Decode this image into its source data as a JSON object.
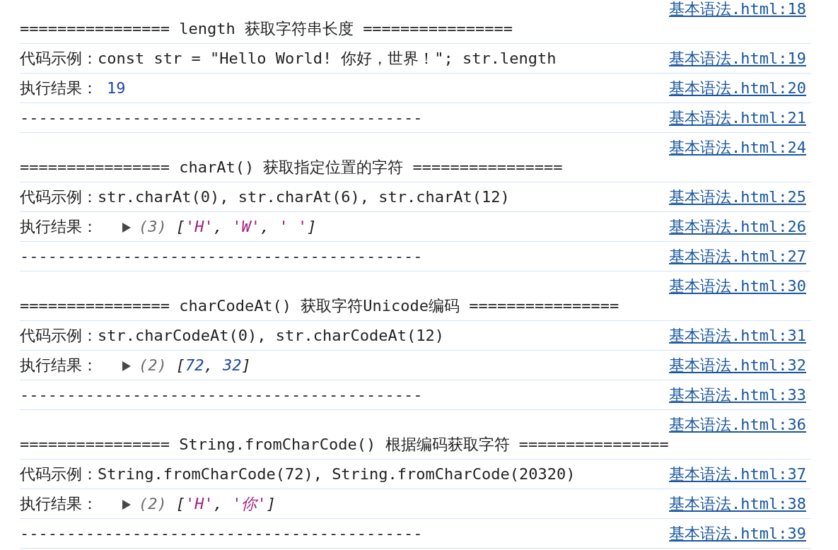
{
  "console": {
    "messages": [
      {
        "kind": "banner",
        "text": "================ length 获取字符串长度 ================",
        "source": "基本语法.html:18"
      },
      {
        "kind": "text",
        "text": "代码示例：const str = \"Hello World! 你好，世界！\"; str.length",
        "source": "基本语法.html:19"
      },
      {
        "kind": "result",
        "label": "执行结果：",
        "value": {
          "kind": "number",
          "text": "19"
        },
        "source": "基本语法.html:20"
      },
      {
        "kind": "text",
        "text": "-------------------------------------------",
        "source": "基本语法.html:21"
      },
      {
        "kind": "banner",
        "text": "================ charAt() 获取指定位置的字符 ================",
        "source": "基本语法.html:24"
      },
      {
        "kind": "text",
        "text": "代码示例：str.charAt(0), str.charAt(6), str.charAt(12)",
        "source": "基本语法.html:25"
      },
      {
        "kind": "result",
        "label": "执行结果：",
        "value": {
          "kind": "array",
          "expanded": false,
          "count": "(3)",
          "brackets": [
            "[",
            "]"
          ],
          "delimiter": ",",
          "items": [
            {
              "kind": "string",
              "text": "'H'"
            },
            {
              "kind": "string",
              "text": "'W'"
            },
            {
              "kind": "string",
              "text": "' '"
            }
          ]
        },
        "source": "基本语法.html:26"
      },
      {
        "kind": "text",
        "text": "-------------------------------------------",
        "source": "基本语法.html:27"
      },
      {
        "kind": "banner",
        "text": "================ charCodeAt() 获取字符Unicode编码 ================",
        "source": "基本语法.html:30"
      },
      {
        "kind": "text",
        "text": "代码示例：str.charCodeAt(0), str.charCodeAt(12)",
        "source": "基本语法.html:31"
      },
      {
        "kind": "result",
        "label": "执行结果：",
        "value": {
          "kind": "array",
          "expanded": false,
          "count": "(2)",
          "brackets": [
            "[",
            "]"
          ],
          "delimiter": ",",
          "items": [
            {
              "kind": "number",
              "text": "72"
            },
            {
              "kind": "number",
              "text": "32"
            }
          ]
        },
        "source": "基本语法.html:32"
      },
      {
        "kind": "text",
        "text": "-------------------------------------------",
        "source": "基本语法.html:33"
      },
      {
        "kind": "banner",
        "text": "================ String.fromCharCode() 根据编码获取字符 ================",
        "source": "基本语法.html:36"
      },
      {
        "kind": "text",
        "text": "代码示例：String.fromCharCode(72), String.fromCharCode(20320)",
        "source": "基本语法.html:37"
      },
      {
        "kind": "result",
        "label": "执行结果：",
        "value": {
          "kind": "array",
          "expanded": false,
          "count": "(2)",
          "brackets": [
            "[",
            "]"
          ],
          "delimiter": ",",
          "items": [
            {
              "kind": "string",
              "text": "'H'"
            },
            {
              "kind": "string",
              "text": "'你'"
            }
          ]
        },
        "source": "基本语法.html:38"
      },
      {
        "kind": "text",
        "text": "-------------------------------------------",
        "source": "基本语法.html:39"
      }
    ]
  }
}
